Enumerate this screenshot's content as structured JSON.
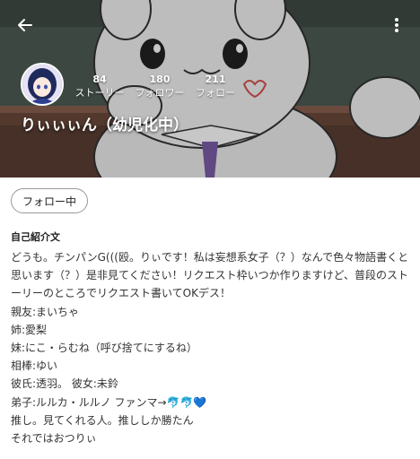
{
  "header": {
    "username": "りぃぃぃん（幼児化中）",
    "stats": [
      {
        "value": "84",
        "label": "ストーリー"
      },
      {
        "value": "180",
        "label": "フォロワー"
      },
      {
        "value": "211",
        "label": "フォロー"
      }
    ],
    "icons": {
      "back": "arrow-left-icon",
      "menu": "more-vertical-icon"
    }
  },
  "actions": {
    "follow_label": "フォロー中"
  },
  "bio": {
    "title": "自己紹介文",
    "lines": [
      "どうも。チンパンG(((殴。りぃです！私は妄想系女子（？）なんで色々物語書くと思います（？）是非見てください！リクエスト枠いつか作りますけど、普段のストーリーのところでリクエスト書いてOKデス！",
      "親友:まいちゃ",
      "姉:愛梨",
      "妹:にこ・らむね（呼び捨てにするね）",
      "相棒:ゆい",
      "彼氏:透羽。 彼女:未鈴",
      "弟子:ルルカ・ルルノ ファンマ→🐬🐬💙",
      "推し。見てくれる人。推ししか勝たん",
      "それではおつりぃ"
    ]
  }
}
